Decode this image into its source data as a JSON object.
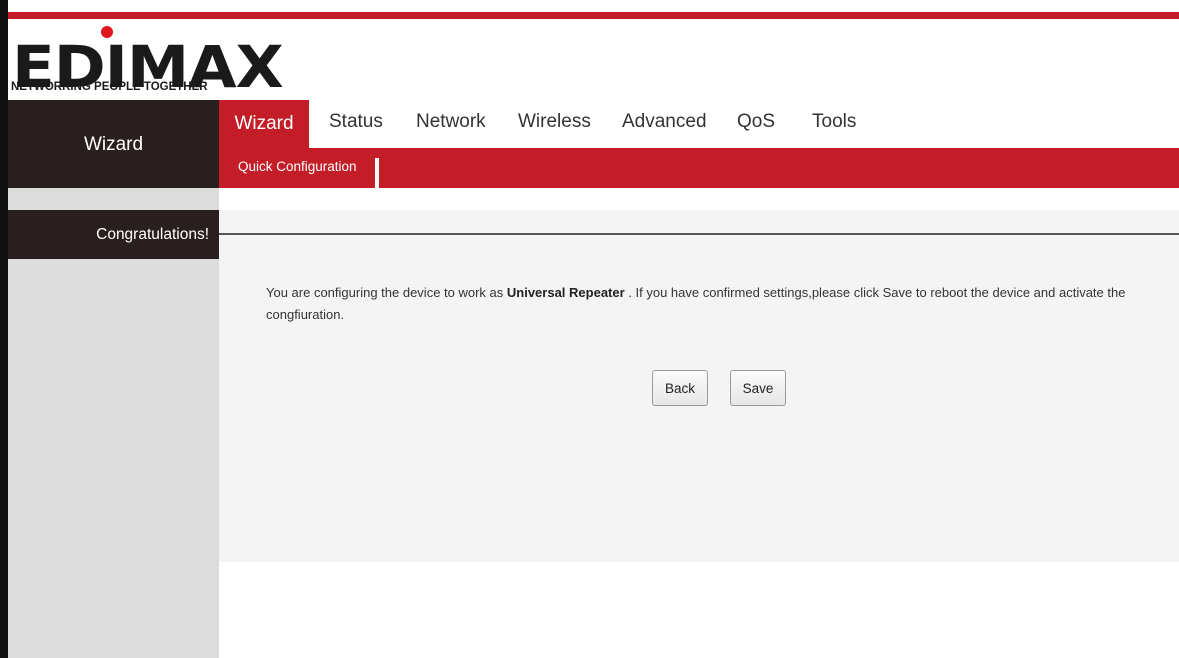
{
  "brand": {
    "logo_text": "EDIMAX",
    "tagline": "NETWORKING PEOPLE TOGETHER",
    "accent_color": "#c31e28"
  },
  "sidebar": {
    "title": "Wizard",
    "items": [
      {
        "label": "Congratulations!"
      }
    ]
  },
  "nav": {
    "tabs": [
      {
        "label": "Wizard",
        "active": true
      },
      {
        "label": "Status"
      },
      {
        "label": "Network"
      },
      {
        "label": "Wireless"
      },
      {
        "label": "Advanced"
      },
      {
        "label": "QoS"
      },
      {
        "label": "Tools"
      }
    ],
    "subtabs": [
      {
        "label": "Quick Configuration",
        "active": true
      }
    ]
  },
  "content": {
    "message_before": "You are configuring the device to work as ",
    "mode": "Universal Repeater",
    "message_after": " . If you have confirmed settings,please click Save to reboot the device and activate the congfiuration.",
    "back_label": "Back",
    "save_label": "Save"
  }
}
